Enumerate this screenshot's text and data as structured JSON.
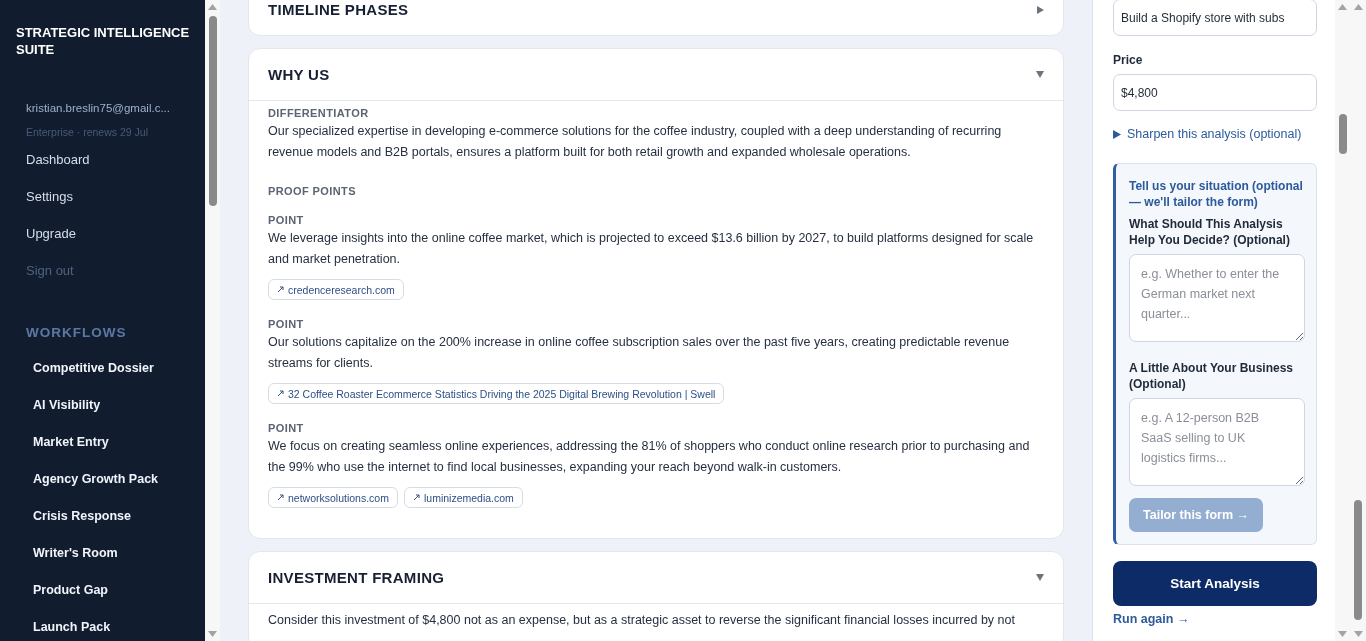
{
  "sidebar": {
    "brand": "STRATEGIC INTELLIGENCE SUITE",
    "account": "kristian.breslin75@gmail.c...",
    "plan": "Enterprise · renews 29 Jul",
    "nav": [
      {
        "label": "Dashboard",
        "disabled": false
      },
      {
        "label": "Settings",
        "disabled": false
      },
      {
        "label": "Upgrade",
        "disabled": false
      },
      {
        "label": "Sign out",
        "disabled": true
      }
    ],
    "workflows_heading": "WORKFLOWS",
    "workflows": [
      "Competitive Dossier",
      "AI Visibility",
      "Market Entry",
      "Agency Growth Pack",
      "Crisis Response",
      "Writer's Room",
      "Product Gap",
      "Launch Pack"
    ]
  },
  "sections": [
    {
      "title": "TIMELINE PHASES",
      "expanded": false
    },
    {
      "kind": "why",
      "title": "WHY US",
      "expanded": true,
      "differentiator_label": "DIFFERENTIATOR",
      "differentiator": "Our specialized expertise in developing e-commerce solutions for the coffee industry, coupled with a deep understanding of recurring revenue models and B2B portals, ensures a platform built for both retail growth and expanded wholesale operations.",
      "proof_label": "PROOF POINTS",
      "points": [
        {
          "label": "POINT",
          "text": "We leverage insights into the online coffee market, which is projected to exceed $13.6 billion by 2027, to build platforms designed for scale and market penetration.",
          "sources": [
            "credenceresearch.com"
          ]
        },
        {
          "label": "POINT",
          "text": "Our solutions capitalize on the 200% increase in online coffee subscription sales over the past five years, creating predictable revenue streams for clients.",
          "sources": [
            "32 Coffee Roaster Ecommerce Statistics Driving the 2025 Digital Brewing Revolution | Swell"
          ]
        },
        {
          "label": "POINT",
          "text": "We focus on creating seamless online experiences, addressing the 81% of shoppers who conduct online research prior to purchasing and the 99% who use the internet to find local businesses, expanding your reach beyond walk-in customers.",
          "sources": [
            "networksolutions.com",
            "luminizemedia.com"
          ]
        }
      ]
    },
    {
      "kind": "text",
      "title": "INVESTMENT FRAMING",
      "expanded": true,
      "body": "Consider this investment of $4,800 not as an expense, but as a strategic asset to reverse the significant financial losses incurred by not"
    }
  ],
  "form": {
    "fields": [
      {
        "value": "Build a Shopify store with subs"
      },
      {
        "label": "Price",
        "value": "$4,800"
      }
    ],
    "sharpen": {
      "label": "Sharpen this analysis (optional)",
      "expanded": false
    },
    "tailor": {
      "heading": "Tell us your situation (optional — we'll tailor the form)",
      "questions": [
        {
          "label": "What Should This Analysis Help You Decide? (Optional)",
          "placeholder": "e.g. Whether to enter the German market next quarter..."
        },
        {
          "label": "A Little About Your Business (Optional)",
          "placeholder": "e.g. A 12-person B2B SaaS selling to UK logistics firms..."
        }
      ],
      "button": {
        "label": "Tailor this form →",
        "disabled": true
      }
    },
    "start_button": "Start Analysis",
    "run_again": "Run again →"
  }
}
